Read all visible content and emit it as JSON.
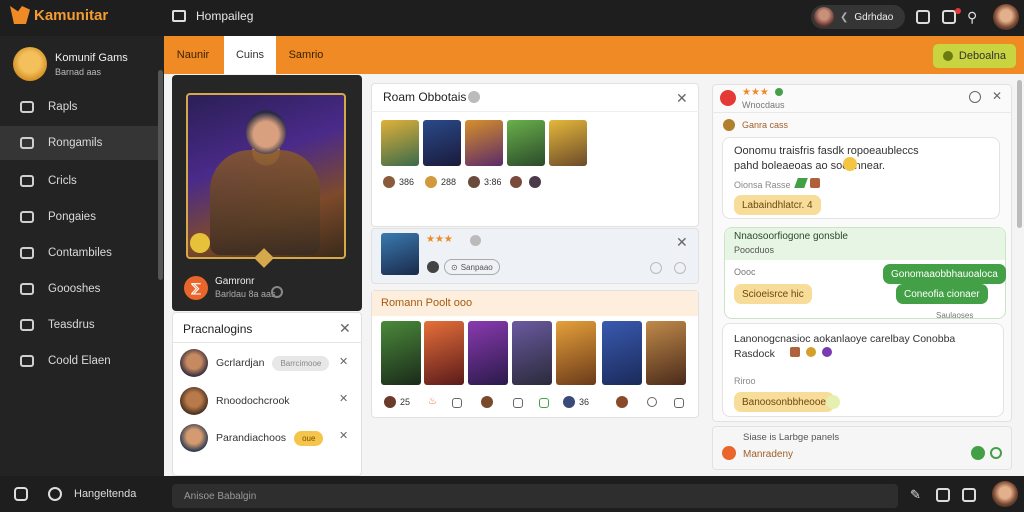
{
  "app": {
    "name": "Kamunitar",
    "title": "Kamunitar"
  },
  "topbar": {
    "page_label": "Hompaileg",
    "user_pill_label": "Gdrhdao"
  },
  "sidebar": {
    "profile_name": "Komunif Gams",
    "profile_sub": "Barnad aas",
    "items": [
      {
        "label": "Rapls"
      },
      {
        "label": "Rongamils"
      },
      {
        "label": "Cricls"
      },
      {
        "label": "Pongaies"
      },
      {
        "label": "Contambiles"
      },
      {
        "label": "Goooshes"
      },
      {
        "label": "Teasdrus"
      },
      {
        "label": "Coold Elaen"
      }
    ]
  },
  "tabs": {
    "items": [
      "Naunir",
      "Cuins",
      "Samrio"
    ],
    "action_button": "Deboalna"
  },
  "hero": {
    "name": "Gamronr",
    "sub": "Barldau 8a aas",
    "logo_glyph": "⅀"
  },
  "players_panel": {
    "title": "Pracnalogins",
    "rows": [
      {
        "name": "Gcrlardjan",
        "tag": "Barrcimooe"
      },
      {
        "name": "Rnoodochcrook",
        "tag": ""
      },
      {
        "name": "Parandiachoos",
        "tag": "oue"
      }
    ]
  },
  "roam_panel": {
    "title": "Roam Obbotais",
    "stats": [
      "386",
      "288",
      "3:86"
    ]
  },
  "featured_panel": {
    "stars": "★★★",
    "pill": "Sanpaao"
  },
  "roster_panel": {
    "title": "Romann Poolt ooo",
    "stats": [
      "25",
      "36"
    ]
  },
  "chat": {
    "header_stars": "★★★",
    "header_sub": "Wnocdaus",
    "thread_label": "Ganra cass",
    "msg1": "Oonomu traisfris fasdk ropoeaubleccs pahd boleaeoas ao sooonnear.",
    "msg1_meta": "Oionsa Rasse",
    "msg1_chip": "Labaindhlatcr. 4",
    "section_title": "Nnaosoorfiogone gonsble",
    "section_sub": "Poocduos",
    "section_meta": "Oooc",
    "reply1": "Gonomaaobbhauoaloca",
    "reply2": "Coneofia cionaer",
    "chip2": "Scioeisrce hic",
    "stamp": "Saulaoses",
    "msg2": "Lanonogcnasioc aokanlaoye carelbay Conobba Rasdock",
    "msg2_meta": "Riroo",
    "msg2_chip": "Banoosonbbheooe",
    "notice_title": "Siase is Larbge panels",
    "notice_sub": "Manradeny"
  },
  "bottombar": {
    "label": "Hangeltenda",
    "input_placeholder": "Anisoe Babalgin"
  },
  "colors": {
    "accent": "#f08a24",
    "dark": "#1e1e1e",
    "lime": "#c8d440",
    "green": "#43a047"
  }
}
